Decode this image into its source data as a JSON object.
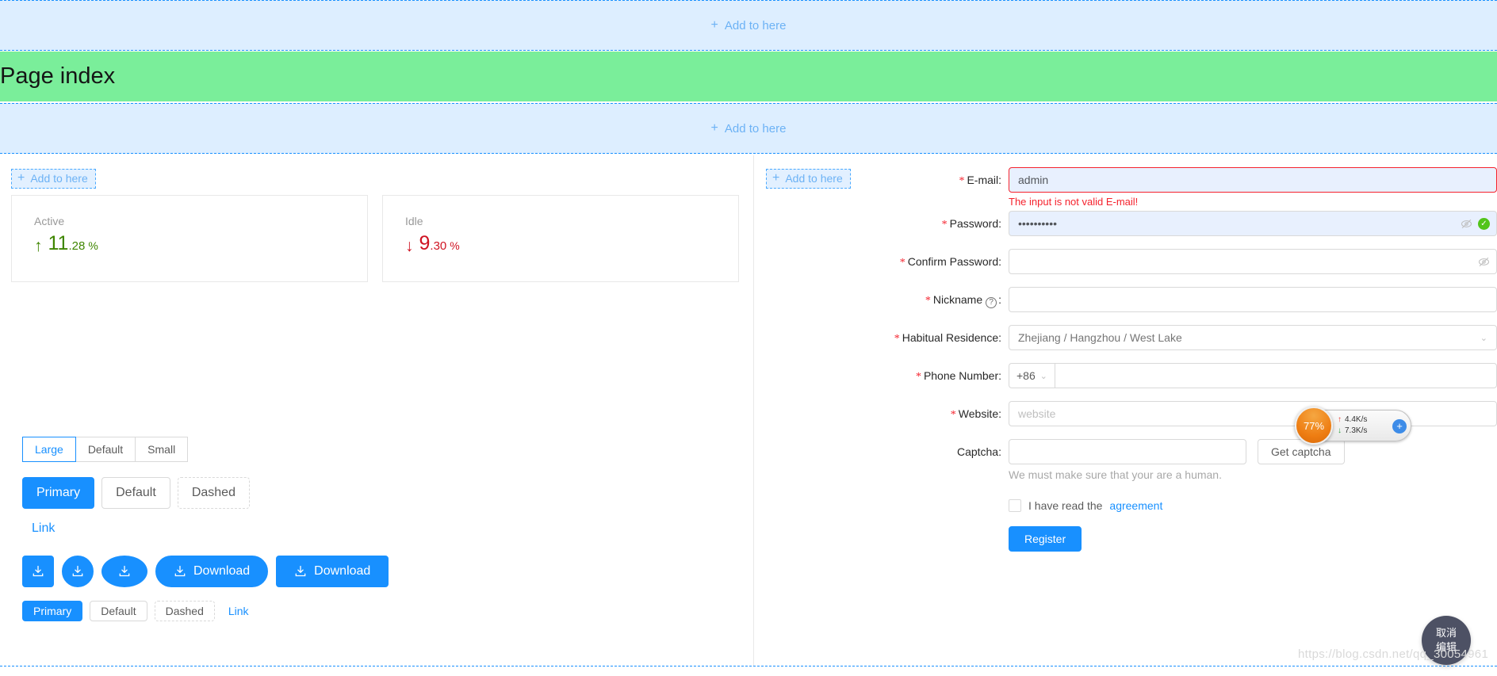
{
  "dropzones": {
    "label": "Add to here",
    "plus_icon": "plus-icon"
  },
  "header": {
    "title": "Page index",
    "band_color": "#7aee9a"
  },
  "left_panel": {
    "add_chip_label": "Add to here",
    "stats": [
      {
        "title": "Active",
        "direction": "up",
        "arrow": "↑",
        "integer": "11",
        "decimal": ".28",
        "unit": "%",
        "color": "#3f8600"
      },
      {
        "title": "Idle",
        "direction": "down",
        "arrow": "↓",
        "integer": "9",
        "decimal": ".30",
        "unit": "%",
        "color": "#cf1322"
      }
    ],
    "size_group": [
      {
        "label": "Large",
        "active": true
      },
      {
        "label": "Default",
        "active": false
      },
      {
        "label": "Small",
        "active": false
      }
    ],
    "large_buttons": [
      {
        "label": "Primary",
        "type": "primary"
      },
      {
        "label": "Default",
        "type": "default"
      },
      {
        "label": "Dashed",
        "type": "dashed"
      }
    ],
    "link_button": "Link",
    "download_buttons": [
      {
        "label": "",
        "icon": "download-icon",
        "shape": "square"
      },
      {
        "label": "",
        "icon": "download-icon",
        "shape": "circle"
      },
      {
        "label": "",
        "icon": "download-icon",
        "shape": "round"
      },
      {
        "label": "Download",
        "icon": "download-icon",
        "shape": "pill"
      },
      {
        "label": "Download",
        "icon": "download-icon",
        "shape": "rect"
      }
    ],
    "small_buttons": [
      {
        "label": "Primary",
        "type": "primary"
      },
      {
        "label": "Default",
        "type": "default"
      },
      {
        "label": "Dashed",
        "type": "dashed"
      },
      {
        "label": "Link",
        "type": "link"
      }
    ]
  },
  "right_panel": {
    "add_chip_label": "Add to here",
    "form": {
      "email": {
        "label": "E-mail",
        "required": true,
        "value": "admin",
        "error": "The input is not valid E-mail!"
      },
      "password": {
        "label": "Password",
        "required": true,
        "value": "••••••••••",
        "eye_icon": "eye-invisible-icon",
        "valid_icon": "check-circle-icon"
      },
      "confirm_password": {
        "label": "Confirm Password",
        "required": true,
        "value": "",
        "eye_icon": "eye-invisible-icon"
      },
      "nickname": {
        "label": "Nickname",
        "required": true,
        "value": "",
        "help_icon": "question-circle-icon"
      },
      "residence": {
        "label": "Habitual Residence",
        "required": true,
        "value": "Zhejiang / Hangzhou / West Lake",
        "caret_icon": "chevron-down-icon"
      },
      "phone": {
        "label": "Phone Number",
        "required": true,
        "country_code": "+86",
        "value": "",
        "caret_icon": "chevron-down-icon"
      },
      "website": {
        "label": "Website",
        "required": true,
        "value": "",
        "placeholder": "website"
      },
      "captcha": {
        "label": "Captcha",
        "required": false,
        "value": "",
        "button_label": "Get captcha",
        "help": "We must make sure that your are a human."
      },
      "agreement": {
        "checked": false,
        "text": "I have read the",
        "link": "agreement"
      },
      "submit": {
        "label": "Register"
      }
    }
  },
  "speed_widget": {
    "percent": "77%",
    "upload": "4.4K/s",
    "download": "7.3K/s",
    "up_arrow": "↑",
    "down_arrow": "↓",
    "plus": "+"
  },
  "cancel_bubble": {
    "line1": "取消",
    "line2": "编辑"
  },
  "watermark": {
    "text": "https://blog.csdn.net/qq_30054961"
  }
}
